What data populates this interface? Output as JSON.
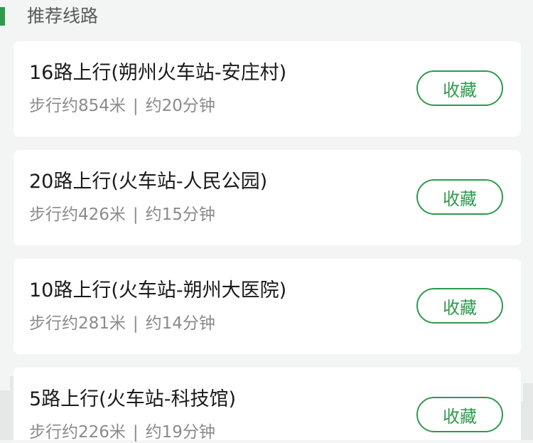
{
  "section": {
    "title": "推荐线路"
  },
  "routes": [
    {
      "title": "16路上行(朔州火车站-安庄村)",
      "walk": "步行约854米",
      "separator": "|",
      "time": "约20分钟",
      "fav_label": "收藏"
    },
    {
      "title": "20路上行(火车站-人民公园)",
      "walk": "步行约426米",
      "separator": "|",
      "time": "约15分钟",
      "fav_label": "收藏"
    },
    {
      "title": "10路上行(火车站-朔州大医院)",
      "walk": "步行约281米",
      "separator": "|",
      "time": "约14分钟",
      "fav_label": "收藏"
    },
    {
      "title": "5路上行(火车站-科技馆)",
      "walk": "步行约226米",
      "separator": "|",
      "time": "约19分钟",
      "fav_label": "收藏"
    }
  ],
  "colors": {
    "accent": "#2e9a4c",
    "background": "#f3f4f4",
    "card": "#ffffff",
    "title_text": "#1a1a1a",
    "meta_text": "#8a8a8a"
  }
}
